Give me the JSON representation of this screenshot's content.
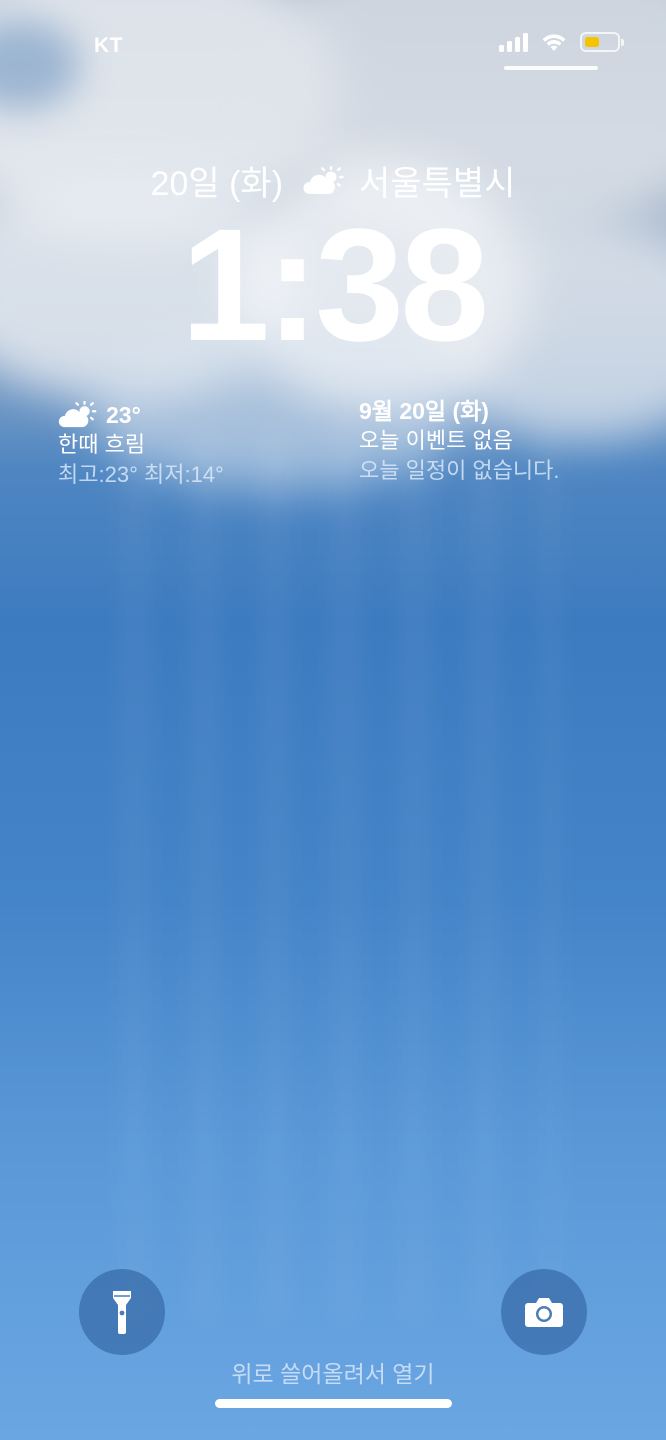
{
  "status_bar": {
    "carrier": "KT",
    "signal_bars": 4,
    "wifi_icon": "wifi-icon",
    "battery_level": 0.45,
    "battery_color": "#f4c400"
  },
  "lock_screen": {
    "date_text": "20일 (화)",
    "weather_icon": "partly-cloudy-icon",
    "city": "서울특별시",
    "time": "1:38"
  },
  "weather_widget": {
    "icon": "partly-cloudy-icon",
    "temperature": "23°",
    "condition": "한때 흐림",
    "range": "최고:23° 최저:14°"
  },
  "calendar_widget": {
    "date": "9월 20일 (화)",
    "events_title": "오늘 이벤트 없음",
    "events_detail": "오늘 일정이 없습니다."
  },
  "bottom": {
    "flashlight_icon": "flashlight-icon",
    "camera_icon": "camera-icon",
    "unlock_hint": "위로 쓸어올려서 열기"
  }
}
